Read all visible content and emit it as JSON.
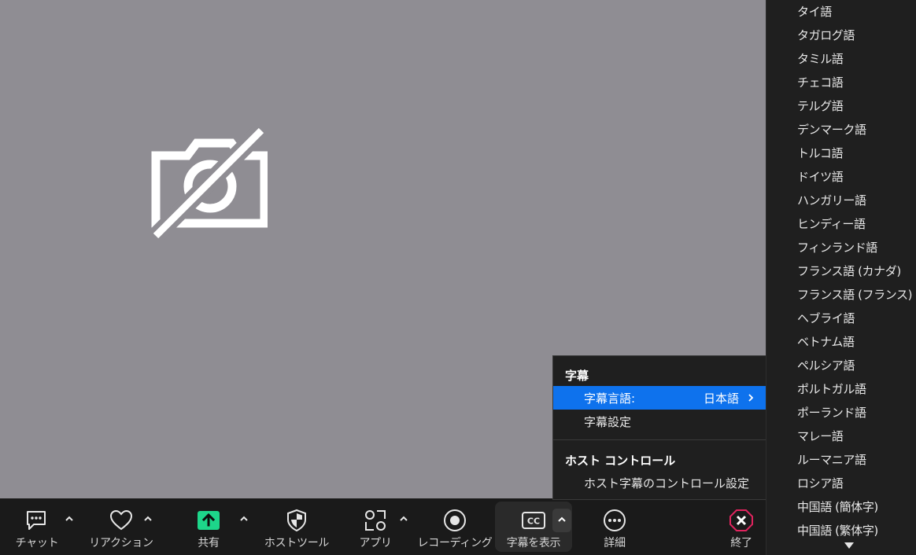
{
  "toolbar": {
    "chat_label": "チャット",
    "reaction_label": "リアクション",
    "share_label": "共有",
    "host_tools_label": "ホストツール",
    "apps_label": "アプリ",
    "recording_label": "レコーディング",
    "captions_label": "字幕を表示",
    "more_label": "詳細",
    "end_label": "終了",
    "share_color": "#1dd68a",
    "end_color": "#e0245e"
  },
  "caption_menu": {
    "heading": "字幕",
    "language_item_label": "字幕言語:",
    "language_item_value": "日本語",
    "settings_item_label": "字幕設定",
    "host_heading": "ホスト コントロール",
    "host_settings_label": "ホスト字幕のコントロール設定",
    "selected_color": "#0e72ed"
  },
  "languages": [
    "タイ語",
    "タガログ語",
    "タミル語",
    "チェコ語",
    "テルグ語",
    "デンマーク語",
    "トルコ語",
    "ドイツ語",
    "ハンガリー語",
    "ヒンディー語",
    "フィンランド語",
    "フランス語 (カナダ)",
    "フランス語 (フランス)",
    "ヘブライ語",
    "ベトナム語",
    "ペルシア語",
    "ポルトガル語",
    "ポーランド語",
    "マレー語",
    "ルーマニア語",
    "ロシア語",
    "中国語 (簡体字)",
    "中国語 (繁体字)"
  ]
}
